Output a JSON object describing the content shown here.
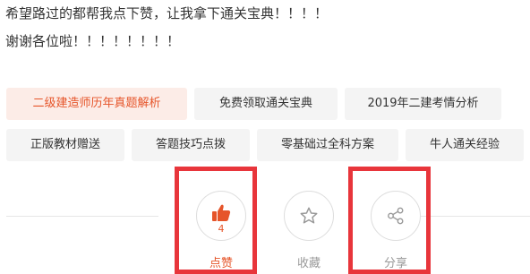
{
  "content": {
    "line1": "希望路过的都帮我点下赞，让我拿下通关宝典！！！！",
    "line2": "谢谢各位啦！！！！！！！！"
  },
  "tags": [
    {
      "label": "二级建造师历年真题解析",
      "active": true
    },
    {
      "label": "免费领取通关宝典"
    },
    {
      "label": "2019年二建考情分析"
    },
    {
      "label": "正版教材赠送"
    },
    {
      "label": "答题技巧点拨"
    },
    {
      "label": "零基础过全科方案"
    },
    {
      "label": "牛人通关经验"
    }
  ],
  "actions": {
    "like": {
      "label": "点赞",
      "count": "4",
      "icon": "thumbs-up-icon"
    },
    "favorite": {
      "label": "收藏",
      "icon": "star-icon"
    },
    "share": {
      "label": "分享",
      "icon": "share-icon"
    }
  },
  "colors": {
    "accent": "#e6552a",
    "highlight": "#e8353b",
    "tag_bg": "#f4f4f4",
    "tag_active_bg": "#fcece7"
  }
}
